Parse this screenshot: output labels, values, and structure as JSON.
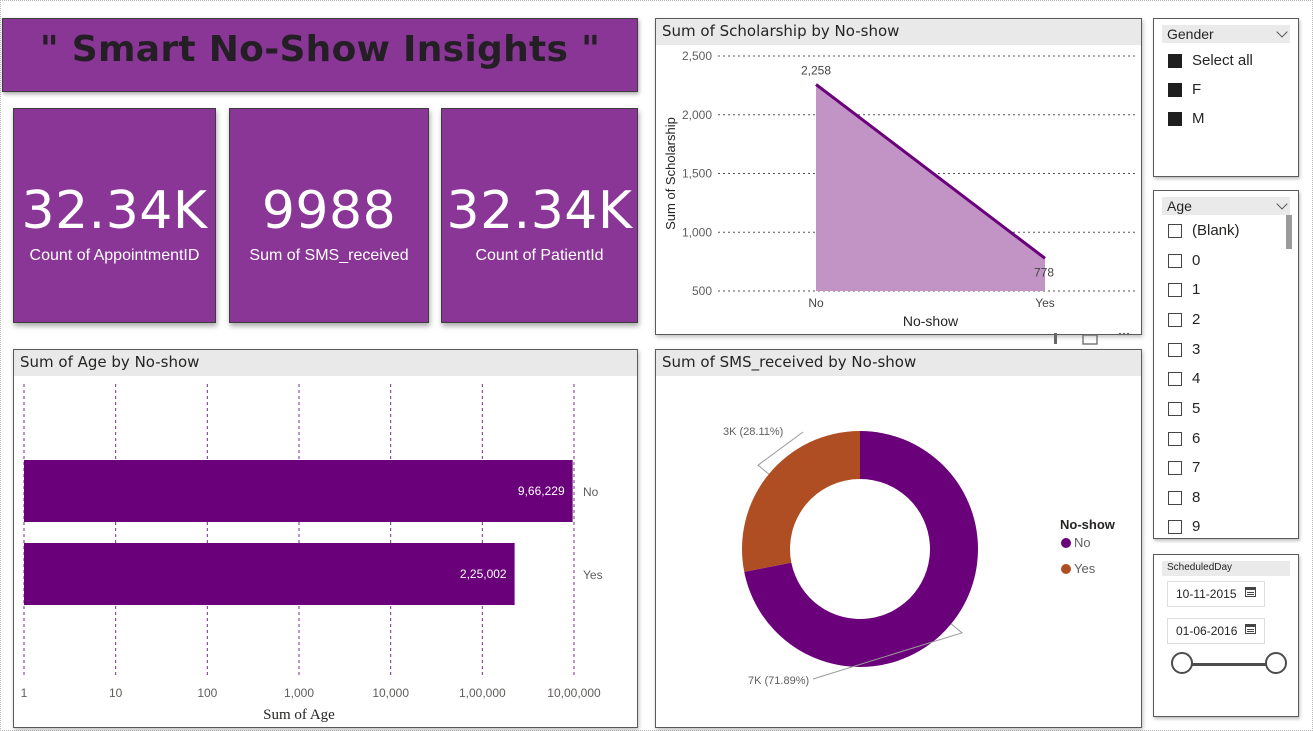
{
  "title": "\" Smart No-Show Insights \"",
  "colors": {
    "brand": "#8a3696",
    "series_no": "#6a007a",
    "series_yes": "#b04e23",
    "area_fill": "#c294c6"
  },
  "kpis": [
    {
      "value": "32.34K",
      "label": "Count of AppointmentID"
    },
    {
      "value": "9988",
      "label": "Sum of SMS_received"
    },
    {
      "value": "32.34K",
      "label": "Count of PatientId"
    }
  ],
  "slicers": {
    "gender": {
      "title": "Gender",
      "items": [
        {
          "label": "Select all",
          "checked": true
        },
        {
          "label": "F",
          "checked": true
        },
        {
          "label": "M",
          "checked": true
        }
      ]
    },
    "age": {
      "title": "Age",
      "items": [
        "(Blank)",
        "0",
        "1",
        "2",
        "3",
        "4",
        "5",
        "6",
        "7",
        "8",
        "9"
      ]
    },
    "scheduled_day": {
      "title": "ScheduledDay",
      "start": "10-11-2015",
      "end": "01-06-2016",
      "calendar_icon": "calendar-icon"
    }
  },
  "chart_data": [
    {
      "type": "area",
      "title": "Sum of Scholarship by No-show",
      "categories": [
        "No",
        "Yes"
      ],
      "values": [
        2258,
        778
      ],
      "data_labels": [
        "2,258",
        "778"
      ],
      "xlabel": "No-show",
      "ylabel": "Sum of Scholarship",
      "ylim": [
        500,
        2500
      ],
      "yticks": [
        500,
        1000,
        1500,
        2000,
        2500
      ],
      "ytick_labels": [
        "500",
        "1,000",
        "1,500",
        "2,000",
        "2,500"
      ],
      "grid": true
    },
    {
      "type": "bar",
      "orientation": "horizontal",
      "title": "Sum of Age by No-show",
      "categories": [
        "No",
        "Yes"
      ],
      "values": [
        966229,
        225002
      ],
      "data_labels": [
        "9,66,229",
        "2,25,002"
      ],
      "xlabel": "Sum of Age",
      "ylabel": "",
      "xscale": "log",
      "xlim": [
        1,
        1000000
      ],
      "xticks": [
        1,
        10,
        100,
        1000,
        10000,
        100000,
        1000000
      ],
      "xtick_labels": [
        "1",
        "10",
        "100",
        "1,000",
        "10,000",
        "1,00,000",
        "10,00,000"
      ],
      "grid": true
    },
    {
      "type": "pie",
      "donut": true,
      "title": "Sum of SMS_received by No-show",
      "categories": [
        "No",
        "Yes"
      ],
      "values": [
        7181,
        2807
      ],
      "percentages": [
        71.89,
        28.11
      ],
      "data_labels": [
        "7K (71.89%)",
        "3K (28.11%)"
      ],
      "legend_title": "No-show",
      "legend_position": "right"
    }
  ]
}
